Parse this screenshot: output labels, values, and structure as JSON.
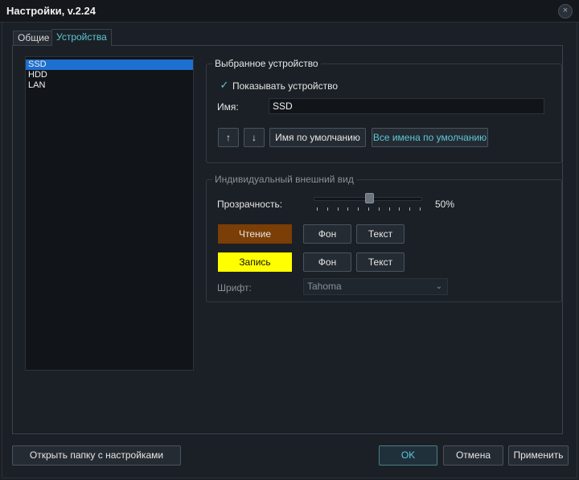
{
  "window": {
    "title": "Настройки, v.2.24",
    "close_glyph": "×"
  },
  "tabs": [
    {
      "label": "Общие"
    },
    {
      "label": "Устройства"
    }
  ],
  "devices": [
    "SSD",
    "HDD",
    "LAN"
  ],
  "selected_device": {
    "legend": "Выбранное устройство",
    "show_label": "Показывать устройство",
    "show_checked": true,
    "name_label": "Имя:",
    "name_value": "SSD",
    "up_glyph": "↑",
    "down_glyph": "↓",
    "default_name_label": "Имя по умолчанию",
    "all_default_names_label": "Все имена по умолчанию"
  },
  "appearance": {
    "legend": "Индивидуальный внешний вид",
    "opacity_label": "Прозрачность:",
    "opacity_value": "50%",
    "opacity_fraction": 0.5,
    "read_label": "Чтение",
    "read_color": "#7a3e06",
    "write_label": "Запись",
    "write_color": "#ffff00",
    "bg_label": "Фон",
    "text_label": "Текст",
    "font_label": "Шрифт:",
    "font_value": "Tahoma"
  },
  "footer": {
    "open_folder_label": "Открыть папку с настройками",
    "ok_label": "OK",
    "cancel_label": "Отмена",
    "apply_label": "Применить"
  },
  "colors": {
    "accent": "#5cc7d9",
    "selection": "#1e6fd0",
    "background": "#1b2026"
  }
}
